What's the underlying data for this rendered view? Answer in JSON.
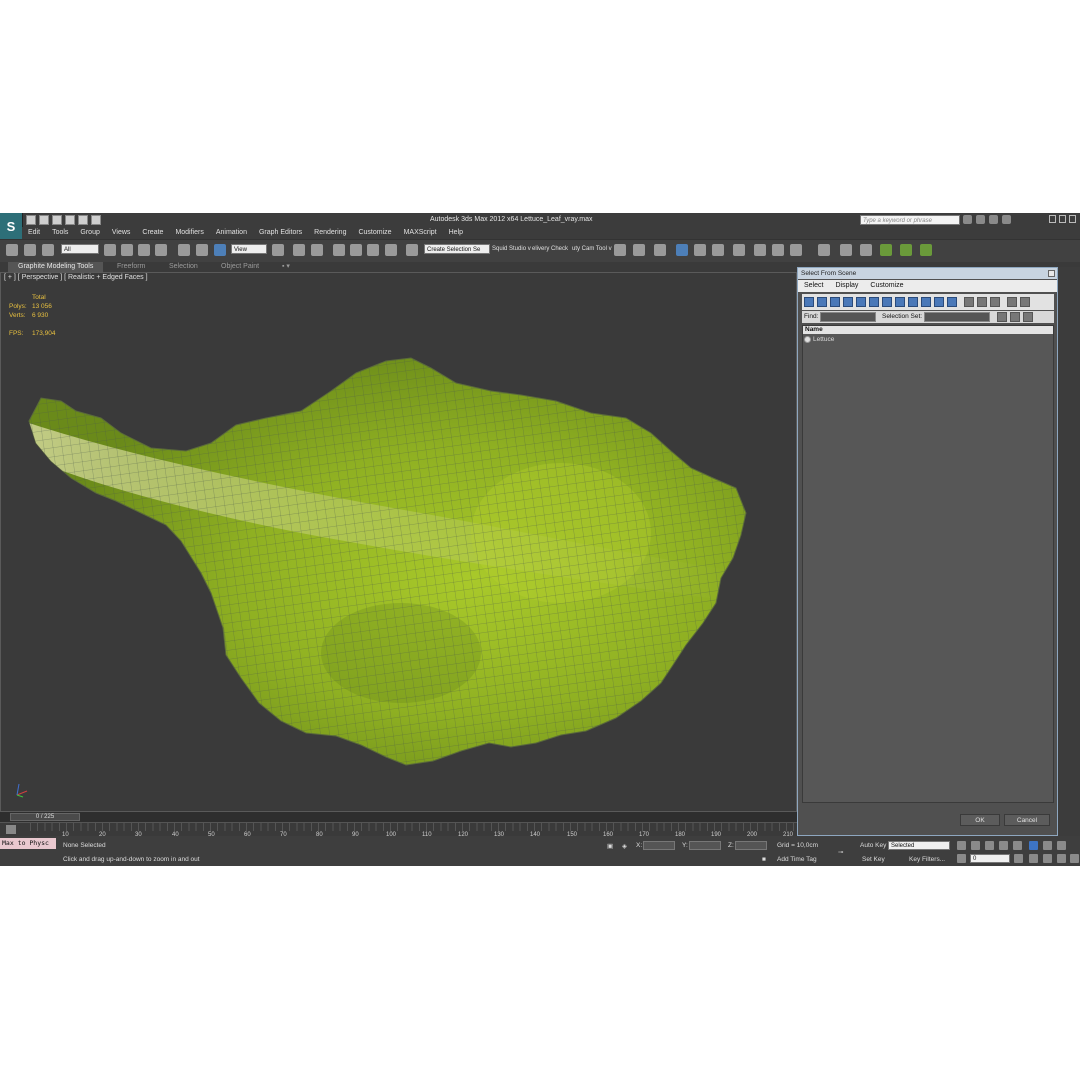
{
  "app": {
    "title": "Autodesk 3ds Max  2012 x64       Lettuce_Leaf_vray.max",
    "search_placeholder": "Type a keyword or phrase"
  },
  "menu": [
    "Edit",
    "Tools",
    "Group",
    "Views",
    "Create",
    "Modifiers",
    "Animation",
    "Graph Editors",
    "Rendering",
    "Customize",
    "MAXScript",
    "Help"
  ],
  "toolbar": {
    "filter_value": "All",
    "ref_coord_value": "View",
    "selection_set_value": "Create Selection Se",
    "text1": "Squid Studio v",
    "text2": "elivery Check",
    "text3": "uty Cam Tool v"
  },
  "ribbon": {
    "tabs": [
      "Graphite Modeling Tools",
      "Freeform",
      "Selection",
      "Object Paint"
    ]
  },
  "viewport": {
    "label": "[ + ] [ Perspective ] [ Realistic + Edged Faces ]",
    "stats_header": "Total",
    "polys_label": "Polys:",
    "polys_value": "13 056",
    "verts_label": "Verts:",
    "verts_value": "6 930",
    "fps_label": "FPS:",
    "fps_value": "173,904"
  },
  "dialog": {
    "title": "Select From Scene",
    "menu": [
      "Select",
      "Display",
      "Customize"
    ],
    "find_label": "Find:",
    "selection_set_label": "Selection Set:",
    "column_name": "Name",
    "items": [
      "Lettuce"
    ],
    "ok_label": "OK",
    "cancel_label": "Cancel"
  },
  "timeline": {
    "slider_text": "0 / 225",
    "ticks": [
      "10",
      "20",
      "30",
      "40",
      "50",
      "60",
      "70",
      "80",
      "90",
      "100",
      "110",
      "120",
      "130",
      "140",
      "150",
      "160",
      "170",
      "180",
      "190",
      "200",
      "210"
    ]
  },
  "status": {
    "maxscript_text": "Max to Physc",
    "selection_text": "None Selected",
    "prompt_text": "Click and drag up-and-down to zoom in and out",
    "x_label": "X:",
    "y_label": "Y:",
    "z_label": "Z:",
    "grid_text": "Grid = 10,0cm",
    "add_time_tag": "Add Time Tag",
    "auto_key": "Auto Key",
    "set_key": "Set Key",
    "key_mode_value": "Selected",
    "key_filters": "Key Filters...",
    "frame_value": "0"
  },
  "colors": {
    "leaf_green": "#9dbb2a",
    "stats_yellow": "#e8c040",
    "viewport_bg": "#3a3a3a"
  }
}
